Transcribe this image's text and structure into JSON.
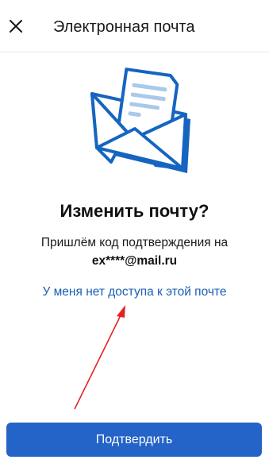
{
  "header": {
    "title": "Электронная почта",
    "close_icon": "close-icon"
  },
  "illustration": {
    "icon": "envelope-with-letter-icon",
    "colors": {
      "primary": "#1565c0",
      "letter_lines": "#a9c9ea",
      "envelope_fill": "#ffffff"
    }
  },
  "main": {
    "heading": "Изменить почту?",
    "description": "Пришлём код подтверждения на",
    "email": "ex****@mail.ru",
    "no_access_link": "У меня нет доступа к этой почте"
  },
  "annotation": {
    "arrow_icon": "red-arrow-icon",
    "color": "#e32222"
  },
  "footer": {
    "confirm_label": "Подтвердить",
    "confirm_color": "#2463c8"
  }
}
